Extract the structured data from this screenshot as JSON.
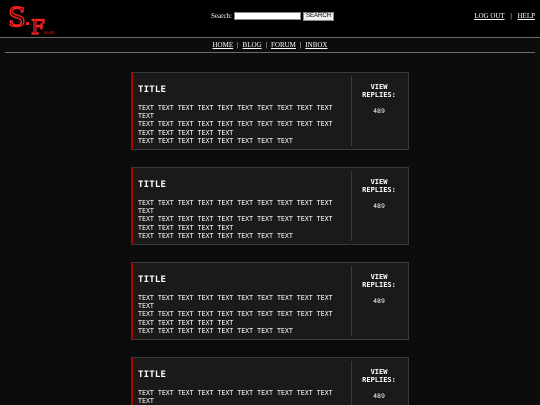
{
  "logo": {
    "text_s": "S",
    "text_f": "F",
    "text_sub": "orum",
    "colors": {
      "primary": "#e00000",
      "outline": "#ff3030"
    }
  },
  "search": {
    "label": "Search:",
    "value": "",
    "placeholder": "",
    "button": "SEARCH"
  },
  "user_links": {
    "logout": "LOG OUT",
    "separator": "|",
    "help": "HELP"
  },
  "nav": {
    "items": [
      "HOME",
      "BLOG",
      "FORUM",
      "INBOX"
    ],
    "separator": "|"
  },
  "posts": [
    {
      "title": "TITLE",
      "body": [
        "TEXT TEXT TEXT TEXT TEXT TEXT TEXT TEXT TEXT TEXT TEXT",
        "TEXT TEXT TEXT TEXT TEXT TEXT TEXT TEXT TEXT TEXT",
        "TEXT TEXT TEXT TEXT TEXT",
        "TEXT TEXT TEXT TEXT TEXT TEXT TEXT TEXT"
      ],
      "view_replies": "VIEW REPLIES:",
      "replies": "489"
    },
    {
      "title": "TITLE",
      "body": [
        "TEXT TEXT TEXT TEXT TEXT TEXT TEXT TEXT TEXT TEXT TEXT",
        "TEXT TEXT TEXT TEXT TEXT TEXT TEXT TEXT TEXT TEXT",
        "TEXT TEXT TEXT TEXT TEXT",
        "TEXT TEXT TEXT TEXT TEXT TEXT TEXT TEXT"
      ],
      "view_replies": "VIEW REPLIES:",
      "replies": "489"
    },
    {
      "title": "TITLE",
      "body": [
        "TEXT TEXT TEXT TEXT TEXT TEXT TEXT TEXT TEXT TEXT TEXT",
        "TEXT TEXT TEXT TEXT TEXT TEXT TEXT TEXT TEXT TEXT",
        "TEXT TEXT TEXT TEXT TEXT",
        "TEXT TEXT TEXT TEXT TEXT TEXT TEXT TEXT"
      ],
      "view_replies": "VIEW REPLIES:",
      "replies": "489"
    },
    {
      "title": "TITLE",
      "body": [
        "TEXT TEXT TEXT TEXT TEXT TEXT TEXT TEXT TEXT TEXT TEXT"
      ],
      "view_replies": "VIEW REPLIES:",
      "replies": "489"
    }
  ]
}
